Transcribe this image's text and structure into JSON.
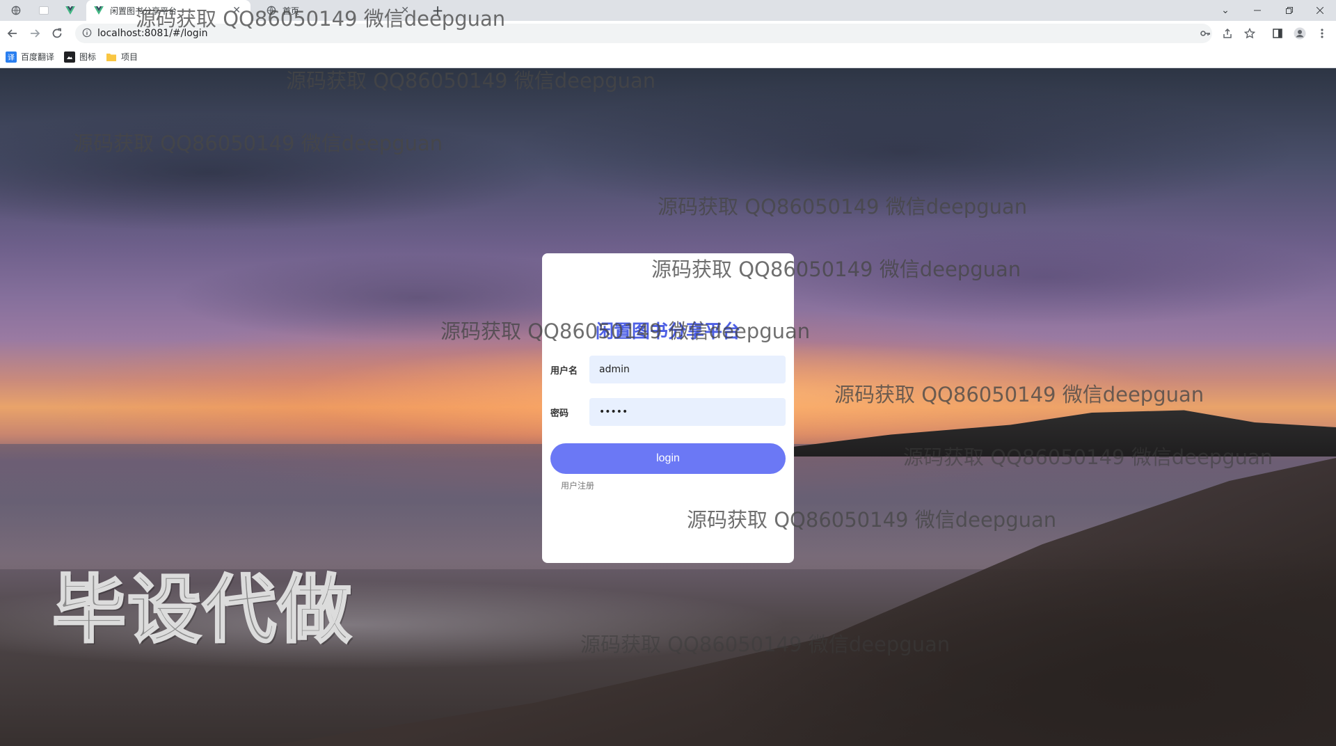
{
  "browser": {
    "tabs": [
      {
        "title": "",
        "icon": "globe-icon"
      },
      {
        "title": "",
        "icon": "blank-page-icon"
      },
      {
        "title": "",
        "icon": "vue-icon"
      },
      {
        "title": "闲置图书分享平台",
        "icon": "vue-icon"
      },
      {
        "title": "首页",
        "icon": "globe-icon"
      }
    ],
    "new_tab_label": "+",
    "url": "localhost:8081/#/login",
    "bookmarks": [
      {
        "label": "百度翻译",
        "icon": "translate-icon",
        "color": "#2a7ff0"
      },
      {
        "label": "图标",
        "icon": "image-icon",
        "color": "#202124"
      },
      {
        "label": "项目",
        "icon": "folder-icon",
        "color": "#f9c642"
      }
    ]
  },
  "login": {
    "title": "闲置图书分享平台",
    "username_label": "用户名",
    "username_value": "admin",
    "password_label": "密码",
    "password_value": "admin",
    "login_button": "login",
    "register_link": "用户注册"
  },
  "watermark": {
    "text": "源码获取 QQ86050149 微信deepguan",
    "big_text": "毕设代做"
  },
  "colors": {
    "accent": "#4d5fe4",
    "button": "#6b78f5",
    "input_bg": "#e8f0fe"
  }
}
